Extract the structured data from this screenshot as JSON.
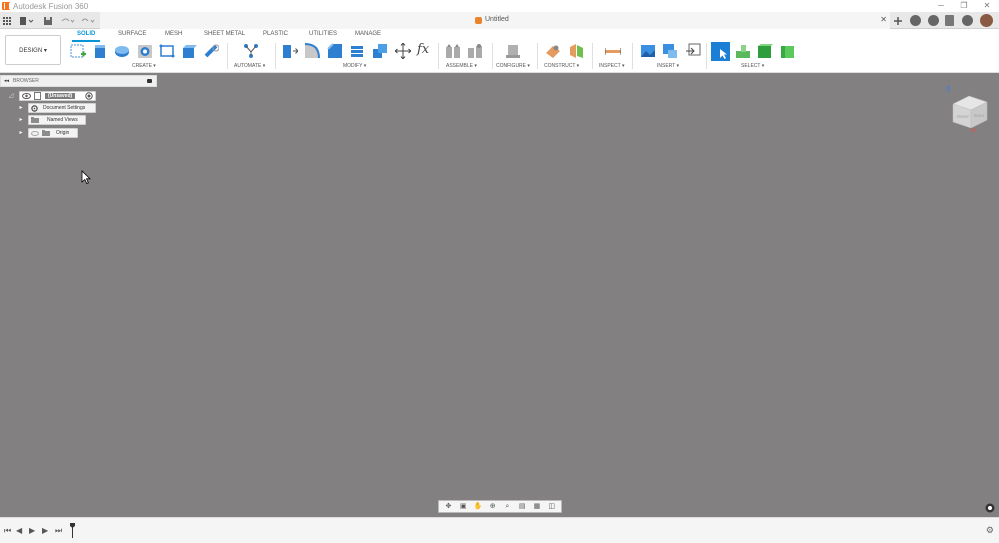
{
  "window": {
    "title": "Autodesk Fusion 360",
    "controls": [
      "─",
      "❐",
      "✕"
    ]
  },
  "doc_tab": {
    "title": "Untitled",
    "close": "✕"
  },
  "toolbar": {
    "design_label": "DESIGN ▾",
    "workspace_tabs": [
      "SOLID",
      "SURFACE",
      "MESH",
      "SHEET METAL",
      "PLASTIC",
      "UTILITIES",
      "MANAGE"
    ],
    "active_tab": "SOLID",
    "groups": {
      "create": "CREATE ▾",
      "automate": "AUTOMATE ▾",
      "modify": "MODIFY ▾",
      "assemble": "ASSEMBLE ▾",
      "configure": "CONFIGURE ▾",
      "construct": "CONSTRUCT ▾",
      "inspect": "INSPECT ▾",
      "insert": "INSERT ▾",
      "select": "SELECT ▾"
    },
    "fx_label": "fx"
  },
  "browser": {
    "title": "BROWSER",
    "collapse": "◂◂",
    "root": "(Unsaved)",
    "items": [
      "Document Settings",
      "Named Views",
      "Origin"
    ]
  },
  "viewcube": {
    "axis_z": "Z",
    "axis_x": "X",
    "face_front": "FRONT",
    "face_right": "RIGHT"
  },
  "colors": {
    "canvas": "#838081",
    "accent": "#0696d7",
    "brand": "#f37321"
  }
}
